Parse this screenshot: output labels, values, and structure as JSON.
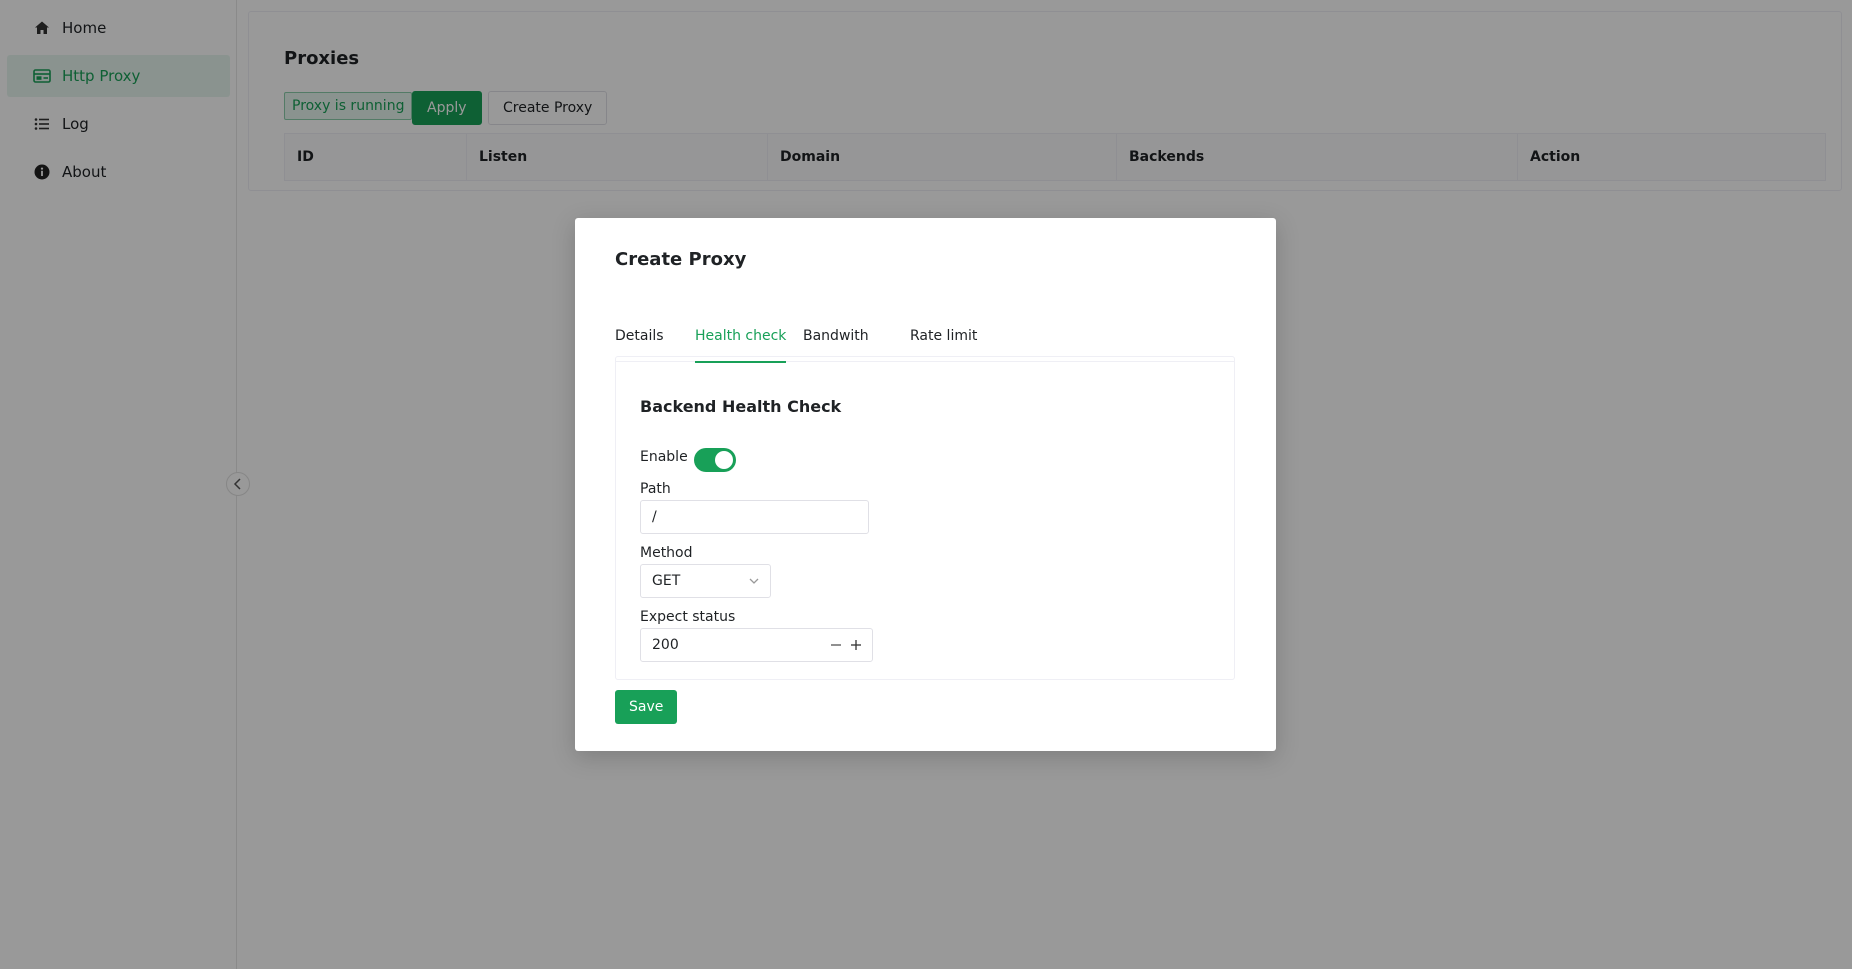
{
  "sidebar": {
    "items": [
      {
        "label": "Home",
        "icon": "home-icon"
      },
      {
        "label": "Http Proxy",
        "icon": "proxy-icon",
        "active": true
      },
      {
        "label": "Log",
        "icon": "list-icon"
      },
      {
        "label": "About",
        "icon": "info-icon"
      }
    ]
  },
  "colors": {
    "accent": "#18a058",
    "accent_bg": "#e7f5ee",
    "overlay": "rgba(0,0,0,0.40)"
  },
  "page": {
    "title": "Proxies",
    "status_tag": "Proxy is running",
    "apply_label": "Apply",
    "create_label": "Create Proxy",
    "table": {
      "columns": [
        "ID",
        "Listen",
        "Domain",
        "Backends",
        "Action"
      ]
    }
  },
  "modal": {
    "title": "Create Proxy",
    "tabs": [
      "Details",
      "Health check",
      "Bandwith",
      "Rate limit"
    ],
    "active_tab": "Health check",
    "section_title": "Backend Health Check",
    "enable_label": "Enable",
    "enable_value": true,
    "path_label": "Path",
    "path_value": "/",
    "method_label": "Method",
    "method_value": "GET",
    "expect_status_label": "Expect status",
    "expect_status_value": "200",
    "save_label": "Save"
  }
}
